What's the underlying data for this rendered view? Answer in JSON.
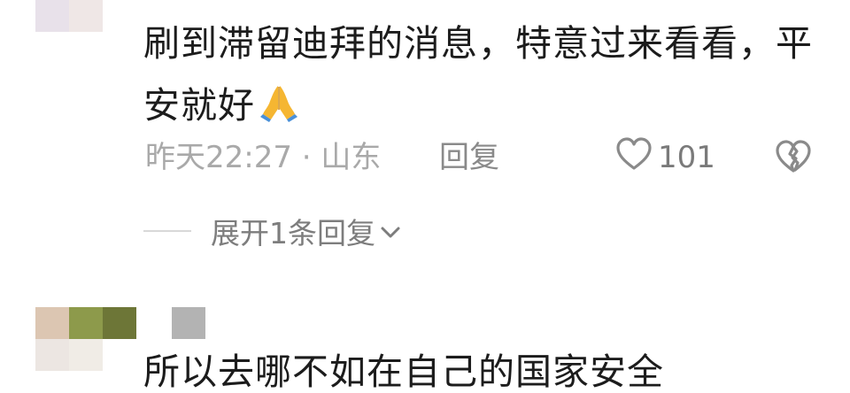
{
  "comment": {
    "text": "刷到滞留迪拜的消息，特意过来看看，平安就好",
    "time": "昨天22:27",
    "separator": " · ",
    "location": "山东",
    "reply_label": "回复",
    "like_count": "101",
    "expand_label": "展开1条回复",
    "emoji_icon": "folded-hands-icon"
  },
  "next_comment": {
    "text_partial": "所以去哪不如在自己的国家安全"
  },
  "colors": {
    "text": "#1c1c1c",
    "meta": "#a9a9a9",
    "action": "#8a8a8a"
  }
}
